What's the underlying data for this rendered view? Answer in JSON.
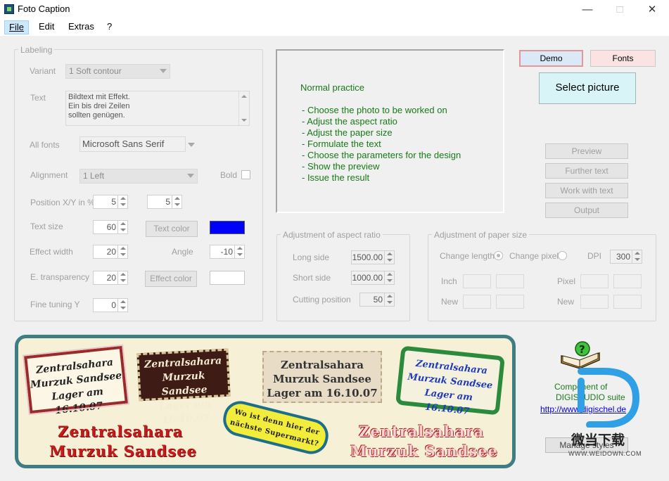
{
  "window": {
    "title": "Foto Caption",
    "icon": "foto-caption-app-icon",
    "controls": [
      "minimize-icon",
      "maximize-icon",
      "close-icon"
    ]
  },
  "menu": {
    "file": "File",
    "edit": "Edit",
    "extras": "Extras",
    "help": "?"
  },
  "labeling": {
    "title": "Labeling",
    "variant_label": "Variant",
    "variant_value": "1 Soft contour",
    "text_label": "Text",
    "text_lines": [
      "Bildtext mit Effekt.",
      "Ein bis drei Zeilen",
      "sollten genügen."
    ],
    "all_fonts_label": "All fonts",
    "font_value": "Microsoft Sans Serif",
    "alignment_label": "Alignment",
    "alignment_value": "1 Left",
    "bold_label": "Bold",
    "position_label": "Position X/Y in %",
    "pos_x": "5",
    "pos_y": "5",
    "text_size_label": "Text size",
    "text_size": "60",
    "text_color_button": "Text color",
    "text_color": "#0000ff",
    "effect_width_label": "Effect width",
    "effect_width": "20",
    "angle_label": "Angle",
    "angle": "-10",
    "transparency_label": "E. transparency",
    "transparency": "20",
    "effect_color_button": "Effect color",
    "effect_color": "#ffffff",
    "fine_tuning_label": "Fine tuning Y",
    "fine_tuning": "0"
  },
  "info": {
    "heading": "Normal practice",
    "steps": [
      "- Choose the photo to be worked on",
      "- Adjust the aspect ratio",
      "- Adjust the paper size",
      "- Formulate the text",
      "- Choose the parameters for the design",
      "- Show the preview",
      "- Issue the result"
    ]
  },
  "top_buttons": {
    "demo": "Demo",
    "fonts": "Fonts",
    "select_picture": "Select picture"
  },
  "actions": {
    "preview": "Preview",
    "further_text": "Further text",
    "work_with_text": "Work with text",
    "output": "Output"
  },
  "aspect": {
    "title": "Adjustment of aspect ratio",
    "long_side_label": "Long side",
    "long_side": "1500.00",
    "short_side_label": "Short side",
    "short_side": "1000.00",
    "cutting_label": "Cutting position",
    "cutting": "50"
  },
  "paper": {
    "title": "Adjustment of paper size",
    "change_length": "Change length",
    "change_pixel": "Change pixel",
    "dpi_label": "DPI",
    "dpi": "300",
    "inch_label": "Inch",
    "pixel_label": "Pixel",
    "new_label": "New",
    "new_label2": "New"
  },
  "banner": {
    "stamp1": [
      "Zentralsahara",
      "Murzuk Sandsee",
      "Lager am 16.10.07"
    ],
    "stamp2": [
      "Zentralsahara",
      "Murzuk Sandsee",
      "Lager am 16.10.07"
    ],
    "stamp3": [
      "Zentralsahara",
      "Murzuk Sandsee",
      "Lager am 16.10.07"
    ],
    "stamp4": [
      "Zentralsahara",
      "Murzuk Sandsee",
      "Lager am 16.10.07"
    ],
    "bubble": [
      "Wo ist denn hier der",
      "nächste Supermarkt?"
    ],
    "red_left": [
      "Zentralsahara",
      "Murzuk Sandsee"
    ],
    "red_right": [
      "Zentralsahara",
      "Murzuk Sandsee"
    ]
  },
  "component": {
    "line1": "Component of",
    "line2": "DIGISTUDIO suite",
    "link": "http://www.digischel.de",
    "manage_styles": "Manage styles"
  },
  "watermark": {
    "brand": "微当下载",
    "url": "WWW.WEIDOWN.COM"
  }
}
